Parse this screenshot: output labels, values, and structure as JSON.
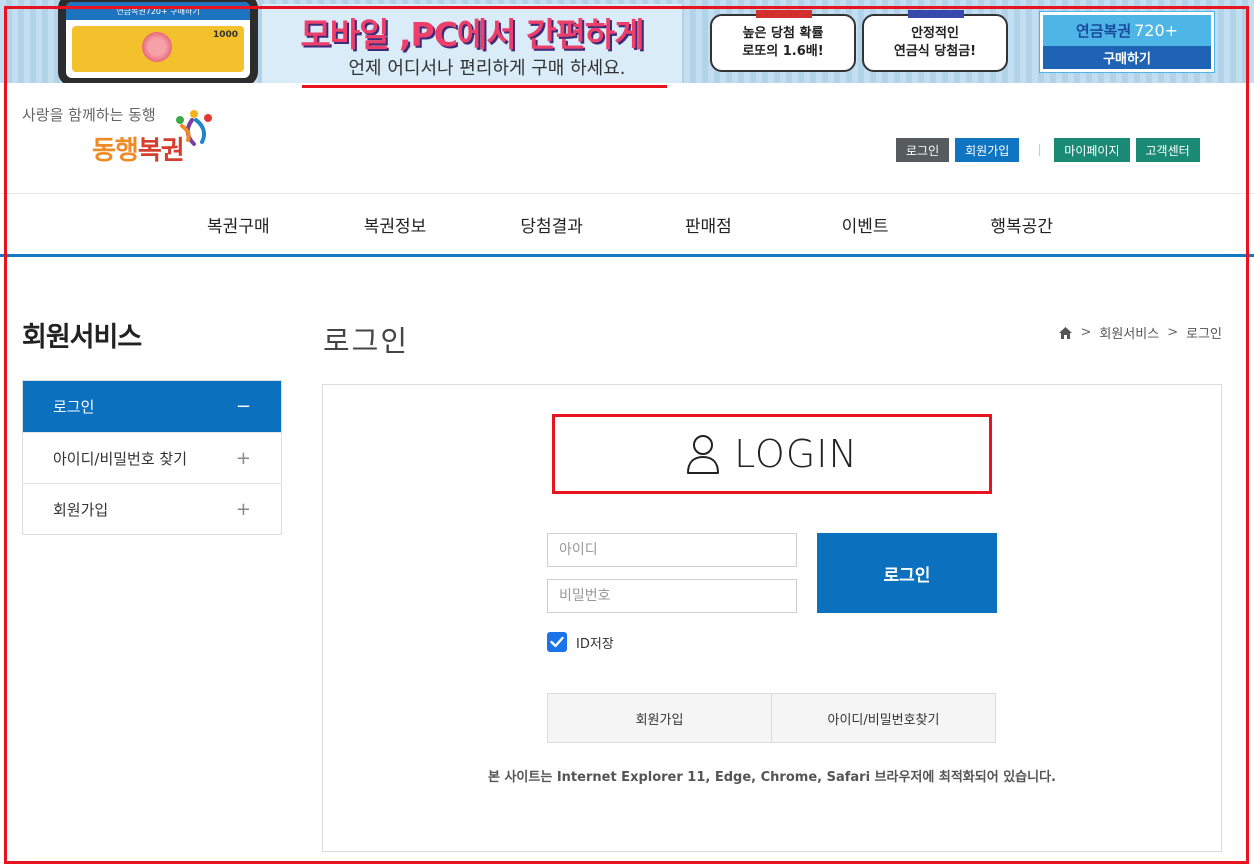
{
  "banner": {
    "phone_bar": "연금복권720+ 구매하기",
    "phone_amount": "1000",
    "slogan_main": "모바일 ,PC에서 간편하게",
    "slogan_sub": "언제 어디서나 편리하게 구매 하세요.",
    "pill1_line1": "높은 당첨 확률",
    "pill1_line2": "로또의 1.6배!",
    "pill2_line1": "안정적인",
    "pill2_line2": "연금식 당첨금!",
    "buy_title": "연금복권",
    "buy_title_sup": "720+",
    "buy_button": "구매하기"
  },
  "header": {
    "tagline": "사랑을 함께하는 동행",
    "brand_a": "동행",
    "brand_b": "복권",
    "links": {
      "login": "로그인",
      "signup": "회원가입",
      "mypage": "마이페이지",
      "support": "고객센터"
    }
  },
  "gnb": [
    "복권구매",
    "복권정보",
    "당첨결과",
    "판매점",
    "이벤트",
    "행복공간"
  ],
  "side": {
    "title": "회원서비스",
    "items": [
      {
        "label": "로그인",
        "sign": "−"
      },
      {
        "label": "아이디/비밀번호 찾기",
        "sign": "+"
      },
      {
        "label": "회원가입",
        "sign": "+"
      }
    ]
  },
  "content": {
    "page_title": "로그인",
    "breadcrumb": [
      "회원서비스",
      "로그인"
    ],
    "login_heading": "LOGIN",
    "id_placeholder": "아이디",
    "pw_placeholder": "비밀번호",
    "login_button": "로그인",
    "save_id_label": "ID저장",
    "save_id_checked": true,
    "signup_button": "회원가입",
    "find_button": "아이디/비밀번호찾기",
    "notice": "본 사이트는 Internet Explorer 11, Edge, Chrome, Safari 브라우저에 최적화되어 있습니다."
  },
  "colors": {
    "primary": "#0b71be",
    "highlight_border": "#e8131f",
    "nav_line": "#1279c3"
  }
}
